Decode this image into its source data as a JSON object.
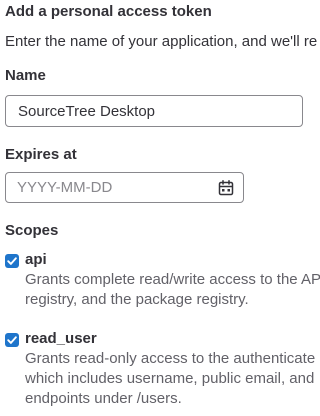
{
  "heading": "Add a personal access token",
  "intro": "Enter the name of your application, and we'll re",
  "name_field": {
    "label": "Name",
    "value": "SourceTree Desktop"
  },
  "expires_field": {
    "label": "Expires at",
    "placeholder": "YYYY-MM-DD",
    "icon": "calendar-icon"
  },
  "scopes": {
    "label": "Scopes",
    "items": [
      {
        "name": "api",
        "checked": true,
        "description_lines": [
          "Grants complete read/write access to the AP",
          "registry, and the package registry."
        ]
      },
      {
        "name": "read_user",
        "checked": true,
        "description_lines": [
          "Grants read-only access to the authenticate",
          "which includes username, public email, and",
          "endpoints under /users."
        ]
      }
    ]
  },
  "colors": {
    "accent": "#1f75cb",
    "text": "#333238",
    "muted": "#626168",
    "border": "#89888d"
  }
}
